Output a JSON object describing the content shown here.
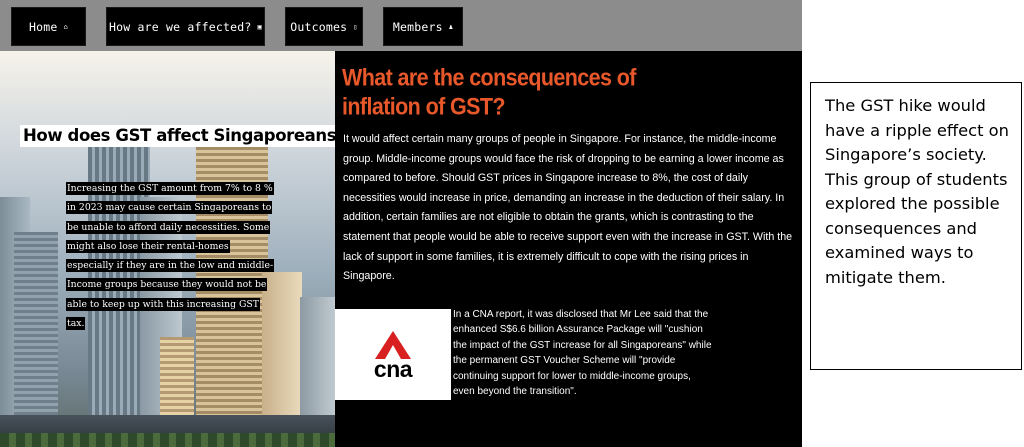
{
  "nav": {
    "items": [
      {
        "label": "Home",
        "icon": "home-icon",
        "glyph": "⌂"
      },
      {
        "label": "How are we affected?",
        "icon": "document-icon",
        "glyph": "▣"
      },
      {
        "label": "Outcomes",
        "icon": "document-icon",
        "glyph": "▯"
      },
      {
        "label": "Members",
        "icon": "people-icon",
        "glyph": "♟"
      }
    ]
  },
  "hero": {
    "heading": "How does GST affect Singaporeans ?",
    "text": "Increasing the GST amount from 7% to 8 % in 2023 may cause certain Singaporeans to be unable to afford daily necessities. Some might also lose their rental-homes especially if they are in the low and middle-Income groups because they would not be able to keep up with this increasing GST tax."
  },
  "main": {
    "title": "What are the consequences  of inflation of GST?",
    "paragraph": "It would affect certain many groups of people in Singapore. For instance, the middle-income group. Middle-income groups would face the risk of dropping to be earning a lower income as compared to before. Should GST prices in Singapore increase to 8%, the cost of daily necessities would increase in price, demanding an increase in the deduction of their salary. In addition, certain families are not eligible to obtain the grants, which is contrasting to the statement that people would be able to receive support even with the increase in GST. With the lack of support in some families, it is extremely difficult to cope with the rising prices in Singapore.",
    "logo_text": "cna",
    "cna_paragraph": "In a CNA report, it was disclosed that Mr Lee said that the enhanced S$6.6 billion Assurance Package will \"cushion the impact of the GST increase for all Singaporeans\" while the permanent GST Voucher Scheme will \"provide continuing support for lower to middle-income groups, even beyond the transition\"."
  },
  "callout": {
    "text": "The GST hike would have a ripple effect on Singapore’s society. This group of students explored the possible consequences and examined ways to mitigate them."
  },
  "colors": {
    "navbar_bg": "#8c8c8c",
    "nav_button_bg": "#000000",
    "title_orange": "#e8582a",
    "cna_red": "#d7201f"
  }
}
